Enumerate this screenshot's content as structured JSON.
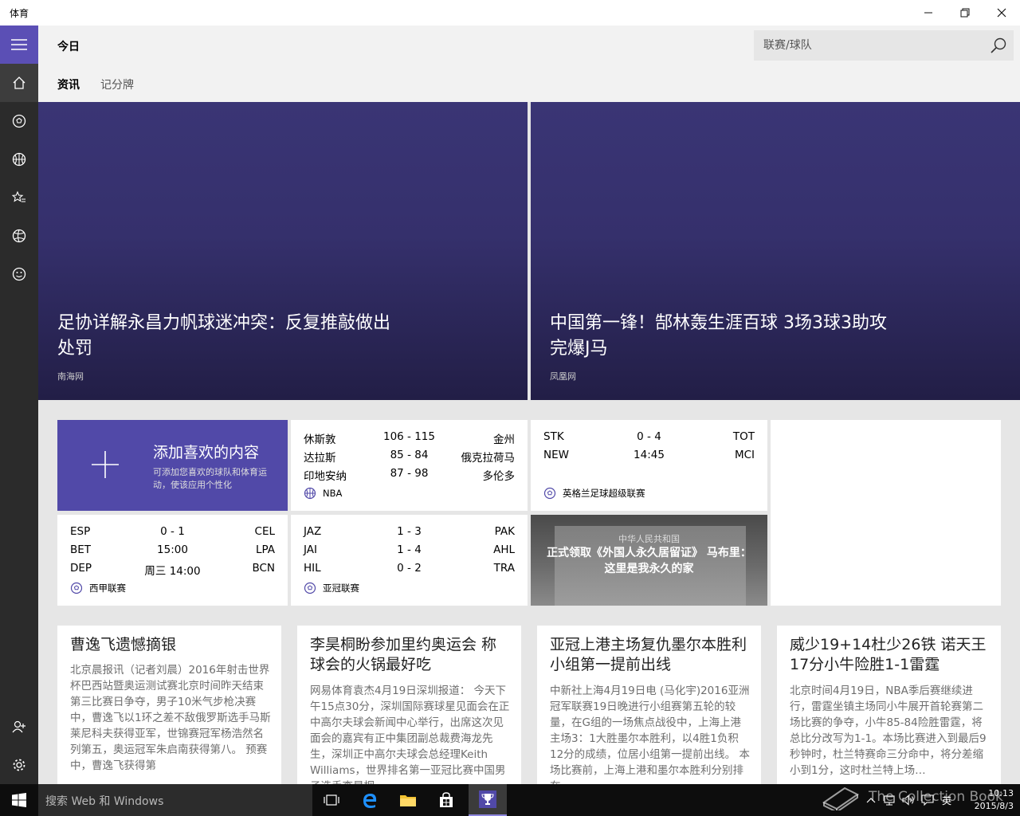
{
  "window": {
    "title": "体育"
  },
  "header": {
    "title": "今日",
    "search_placeholder": "联赛/球队",
    "tabs": [
      {
        "label": "资讯"
      },
      {
        "label": "记分牌"
      }
    ]
  },
  "hero": [
    {
      "title": "足协详解永昌力帆球迷冲突：反复推敲做出处罚",
      "source": "南海网"
    },
    {
      "title": "中国第一锋！郜林轰生涯百球 3场3球3助攻完爆J马",
      "source": "凤凰网"
    }
  ],
  "add_card": {
    "title": "添加喜欢的内容",
    "subtitle": "可添加您喜欢的球队和体育运动，使该应用个性化"
  },
  "scoreboards": {
    "nba": {
      "league": "NBA",
      "rows": [
        {
          "home": "休斯敦",
          "score": "106  -  115",
          "away": "金州"
        },
        {
          "home": "达拉斯",
          "score": "85  -  84",
          "away": "俄克拉荷马"
        },
        {
          "home": "印地安纳",
          "score": "87  -  98",
          "away": "多伦多"
        }
      ]
    },
    "epl": {
      "league": "英格兰足球超级联赛",
      "rows": [
        {
          "home": "STK",
          "score": "0  -  4",
          "away": "TOT"
        },
        {
          "home": "NEW",
          "score": "14:45",
          "away": "MCI"
        }
      ]
    },
    "laliga": {
      "league": "西甲联赛",
      "rows": [
        {
          "home": "ESP",
          "score": "0  -  1",
          "away": "CEL"
        },
        {
          "home": "BET",
          "score": "15:00",
          "away": "LPA"
        },
        {
          "home": "DEP",
          "score": "周三 14:00",
          "away": "BCN"
        }
      ]
    },
    "acl": {
      "league": "亚冠联赛",
      "rows": [
        {
          "home": "JAZ",
          "score": "1  -  3",
          "away": "PAK"
        },
        {
          "home": "JAI",
          "score": "1  -  4",
          "away": "AHL"
        },
        {
          "home": "HIL",
          "score": "0  -  2",
          "away": "TRA"
        }
      ]
    }
  },
  "photo_card": {
    "header": "中华人民共和国",
    "title": "正式领取《外国人永久居留证》 马布里：这里是我永久的家"
  },
  "news": [
    {
      "title": "曹逸飞遗憾摘银",
      "body": "北京晨报讯（记者刘晨）2016年射击世界杯巴西站暨奥运测试赛北京时间昨天结束第三比赛日争夺，男子10米气步枪决赛中，曹逸飞以1环之差不敌俄罗斯选手马斯莱尼科夫获得亚军，世锦赛冠军杨浩然名列第五，奥运冠军朱启南获得第八。 预赛中，曹逸飞获得第"
    },
    {
      "title": "李昊桐盼参加里约奥运会 称球会的火锅最好吃",
      "body": "网易体育袁杰4月19日深圳报道： 今天下午15点30分，深圳国际赛球星见面会在正中高尔夫球会新闻中心举行，出席这次见面会的嘉宾有正中集团副总裁费海龙先生，深圳正中高尔夫球会总经理Keith Williams，世界排名第一亚冠比赛中国男子选手李昊桐…"
    },
    {
      "title": "亚冠上港主场复仇墨尔本胜利 小组第一提前出线",
      "body": "中新社上海4月19日电 (马化宇)2016亚洲冠军联赛19日晚进行小组赛第五轮的较量，在G组的一场焦点战役中，上海上港主场3：1大胜墨尔本胜利，以4胜1负积12分的成绩，位居小组第一提前出线。 本场比赛前，上海上港和墨尔本胜利分别排在…"
    },
    {
      "title": "威少19+14杜少26铁 诺天王17分小牛险胜1-1雷霆",
      "body": "北京时间4月19日，NBA季后赛继续进行，雷霆坐镇主场同小牛展开首轮赛第二场比赛的争夺，小牛85-84险胜雷霆，将总比分改写为1-1。本场比赛进入到最后9秒钟时，杜兰特赛命三分命中，将分差缩小到1分，这时杜兰特上场…"
    }
  ],
  "taskbar": {
    "search_placeholder": "搜索 Web 和 Windows",
    "ime": "英",
    "time": "10:13",
    "date": "2015/8/3"
  },
  "watermark": "The Collection Book",
  "colors": {
    "accent": "#5149a8",
    "sidebar": "#2b2b2b",
    "hero": "#35306c"
  }
}
